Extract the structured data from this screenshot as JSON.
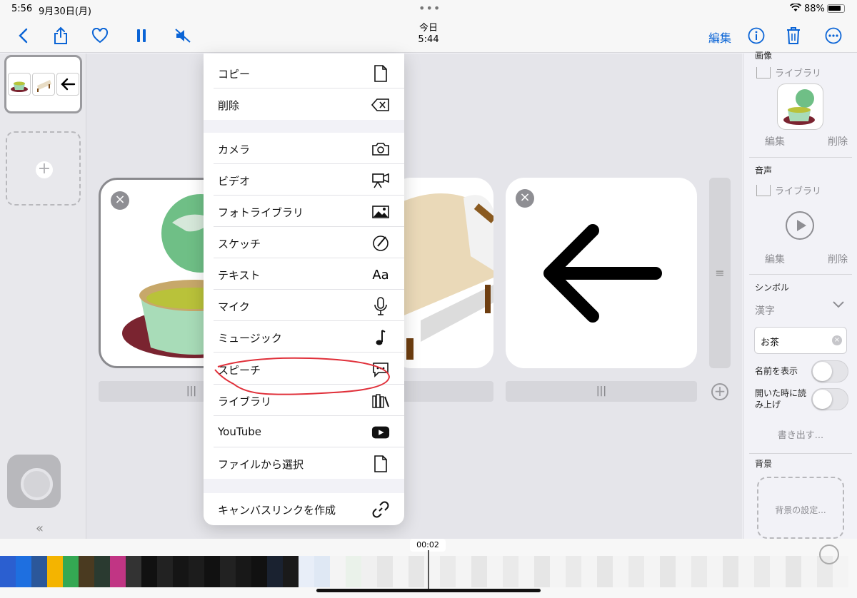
{
  "status": {
    "time": "5:56",
    "date": "9月30日(月)",
    "battery": "88%"
  },
  "toolbar": {
    "title": "今日",
    "subtitle": "5:44",
    "edit_label": "編集"
  },
  "menu": {
    "items": [
      {
        "label": "コピー",
        "icon": "document-icon"
      },
      {
        "label": "削除",
        "icon": "delete-backward-icon"
      },
      {
        "label": "カメラ",
        "icon": "camera-icon"
      },
      {
        "label": "ビデオ",
        "icon": "video-camera-icon"
      },
      {
        "label": "フォトライブラリ",
        "icon": "photo-icon"
      },
      {
        "label": "スケッチ",
        "icon": "pencil-circle-icon"
      },
      {
        "label": "テキスト",
        "icon": "text-aa-icon",
        "glyph": "Aa"
      },
      {
        "label": "マイク",
        "icon": "microphone-icon"
      },
      {
        "label": "ミュージック",
        "icon": "music-note-icon"
      },
      {
        "label": "スピーチ",
        "icon": "speech-bubble-icon"
      },
      {
        "label": "ライブラリ",
        "icon": "books-icon"
      },
      {
        "label": "YouTube",
        "icon": "youtube-icon"
      },
      {
        "label": "ファイルから選択",
        "icon": "file-icon"
      },
      {
        "label": "キャンバスリンクを作成",
        "icon": "link-icon"
      }
    ],
    "highlight_color": "#e0303a"
  },
  "inspector": {
    "image_section": "画像",
    "image_library": "ライブラリ",
    "image_edit": "編集",
    "image_delete": "削除",
    "audio_section": "音声",
    "audio_library": "ライブラリ",
    "audio_edit": "編集",
    "audio_delete": "削除",
    "symbol_section": "シンボル",
    "symbol_type": "漢字",
    "symbol_value": "お茶",
    "show_name_label": "名前を表示",
    "read_on_open_label": "開いた時に読み上げ",
    "export_label": "書き出す...",
    "background_section": "背景",
    "background_button": "背景の設定..."
  },
  "timeline": {
    "time": "00:02"
  },
  "colors": {
    "accent": "#0a64d6",
    "card_border": "#8a8a8e"
  }
}
